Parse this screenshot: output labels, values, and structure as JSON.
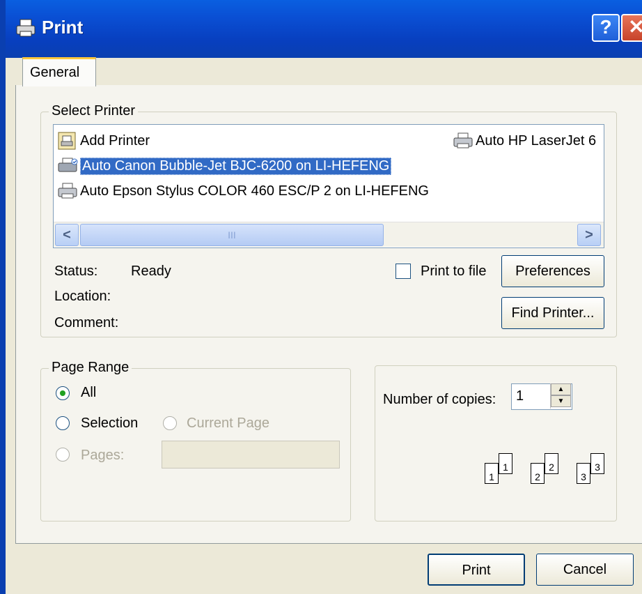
{
  "window": {
    "title": "Print",
    "help_glyph": "?",
    "close_glyph": "✕"
  },
  "tabs": [
    {
      "label": "General"
    }
  ],
  "select_printer": {
    "label": "Select Printer",
    "printers": [
      {
        "name": "Add Printer",
        "icon": "add-printer-icon"
      },
      {
        "name": "Auto Canon Bubble-Jet BJC-6200 on LI-HEFENG",
        "icon": "printer-icon",
        "selected": true
      },
      {
        "name": "Auto Epson Stylus COLOR 460 ESC/P 2 on LI-HEFENG",
        "icon": "printer-icon"
      },
      {
        "name": "Auto HP LaserJet 6",
        "icon": "printer-icon"
      }
    ],
    "scroll_left": "<",
    "scroll_right": ">",
    "scroll_grip": "III",
    "status_label": "Status:",
    "status_value": "Ready",
    "location_label": "Location:",
    "comment_label": "Comment:",
    "print_to_file_label": "Print to file",
    "print_to_file_checked": false,
    "preferences_label": "Preferences",
    "find_printer_label": "Find Printer..."
  },
  "page_range": {
    "label": "Page Range",
    "all_label": "All",
    "selection_label": "Selection",
    "current_page_label": "Current Page",
    "pages_label": "Pages:",
    "selected_option": "All",
    "pages_value": ""
  },
  "copies": {
    "label": "Number of copies:",
    "value": "1",
    "collate_pages": [
      "1",
      "1",
      "2",
      "2",
      "3",
      "3"
    ]
  },
  "buttons": {
    "print": "Print",
    "cancel": "Cancel"
  },
  "colors": {
    "title_bar": "#0a4fd4",
    "selection": "#316ac5",
    "dialog_bg": "#ece9d8"
  }
}
